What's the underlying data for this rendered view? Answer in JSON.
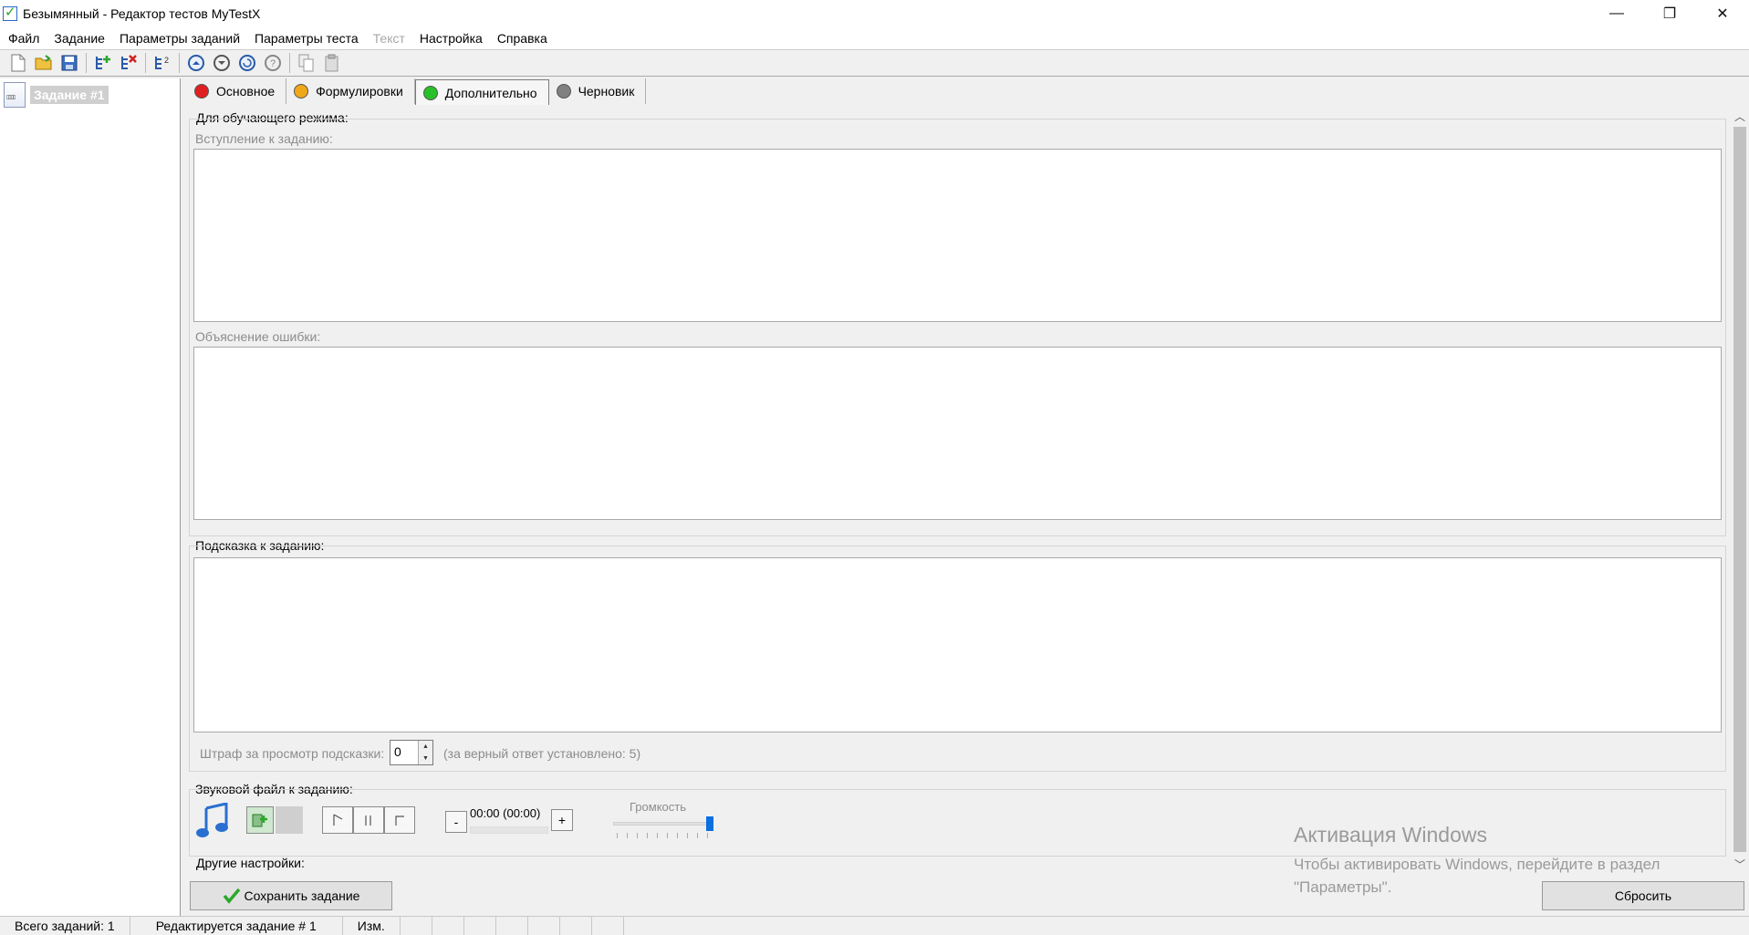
{
  "window": {
    "title": "Безымянный - Редактор тестов MyTestX",
    "minimize": "—",
    "restore": "❐",
    "close": "✕"
  },
  "menu": [
    {
      "label": "Файл",
      "disabled": false
    },
    {
      "label": "Задание",
      "disabled": false
    },
    {
      "label": "Параметры заданий",
      "disabled": false
    },
    {
      "label": "Параметры теста",
      "disabled": false
    },
    {
      "label": "Текст",
      "disabled": true
    },
    {
      "label": "Настройка",
      "disabled": false
    },
    {
      "label": "Справка",
      "disabled": false
    }
  ],
  "toolbar": {
    "icons": [
      "new-file-icon",
      "open-folder-icon",
      "save-icon",
      "add-task-icon",
      "delete-task-icon",
      "task-tree-icon",
      "move-up-icon",
      "move-down-icon",
      "refresh-icon",
      "help-icon",
      "copy-icon",
      "paste-icon"
    ]
  },
  "tree": {
    "item_label": "Задание #1"
  },
  "tabs": [
    {
      "label": "Основное",
      "color": "#e02020"
    },
    {
      "label": "Формулировки",
      "color": "#f0a818"
    },
    {
      "label": "Дополнительно",
      "color": "#28c028"
    },
    {
      "label": "Черновик",
      "color": "#808080"
    }
  ],
  "form": {
    "training_mode_label": "Для обучающего режима:",
    "intro_label": "Вступление к заданию:",
    "error_explanation_label": "Объяснение ошибки:",
    "hint_label": "Подсказка к заданию:",
    "penalty_label": "Штраф за просмотр подсказки:",
    "penalty_value": "0",
    "penalty_note": "(за верный ответ установлено: 5)",
    "sound_label": "Звуковой файл к заданию:",
    "time_display": "00:00 (00:00)",
    "minus": "-",
    "plus": "+",
    "volume_label": "Громкость",
    "volume_level": 1.0,
    "other_settings_label": "Другие настройки:"
  },
  "buttons": {
    "save": "Сохранить задание",
    "reset": "Сбросить"
  },
  "watermark": {
    "title": "Активация Windows",
    "subtitle": "Чтобы активировать Windows, перейдите в раздел \"Параметры\"."
  },
  "status": {
    "total": "Всего заданий: 1",
    "editing": "Редактируется задание # 1",
    "changed": "Изм."
  }
}
